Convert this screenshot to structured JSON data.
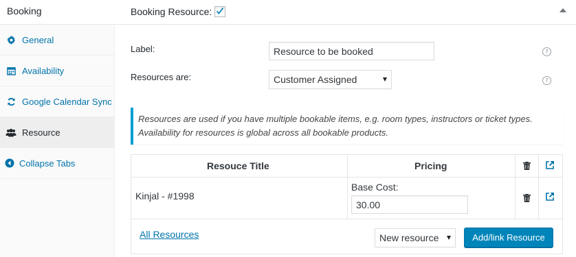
{
  "header": {
    "title": "Booking",
    "resource_label": "Booking Resource:",
    "resource_checked": true
  },
  "sidebar": {
    "items": [
      {
        "label": "General",
        "icon": "gear-icon",
        "active": false
      },
      {
        "label": "Availability",
        "icon": "calendar-icon",
        "active": false
      },
      {
        "label": "Google Calendar Sync",
        "icon": "sync-icon",
        "active": false
      },
      {
        "label": "Resource",
        "icon": "users-icon",
        "active": true
      },
      {
        "label": "Collapse Tabs",
        "icon": "collapse-icon",
        "active": false
      }
    ]
  },
  "form": {
    "label_field": {
      "label": "Label:",
      "value": "Resource to be booked"
    },
    "resources_field": {
      "label": "Resources are:",
      "value": "Customer Assigned"
    },
    "help_glyph": "?"
  },
  "notice": {
    "line1": "Resources are used if you have multiple bookable items, e.g. room types, instructors or ticket types.",
    "line2": "Availability for resources is global across all bookable products."
  },
  "table": {
    "headers": {
      "title": "Resouce Title",
      "pricing": "Pricing"
    },
    "rows": [
      {
        "title": "Kinjal - #1998",
        "base_cost_label": "Base Cost:",
        "base_cost_value": "30.00"
      }
    ]
  },
  "footer": {
    "all_resources_link": "All Resources",
    "new_resource_select": "New resource",
    "add_link_button": "Add/link Resource"
  },
  "colors": {
    "link": "#0073aa",
    "primary_button": "#0085ba",
    "notice_border": "#00a0d2"
  }
}
